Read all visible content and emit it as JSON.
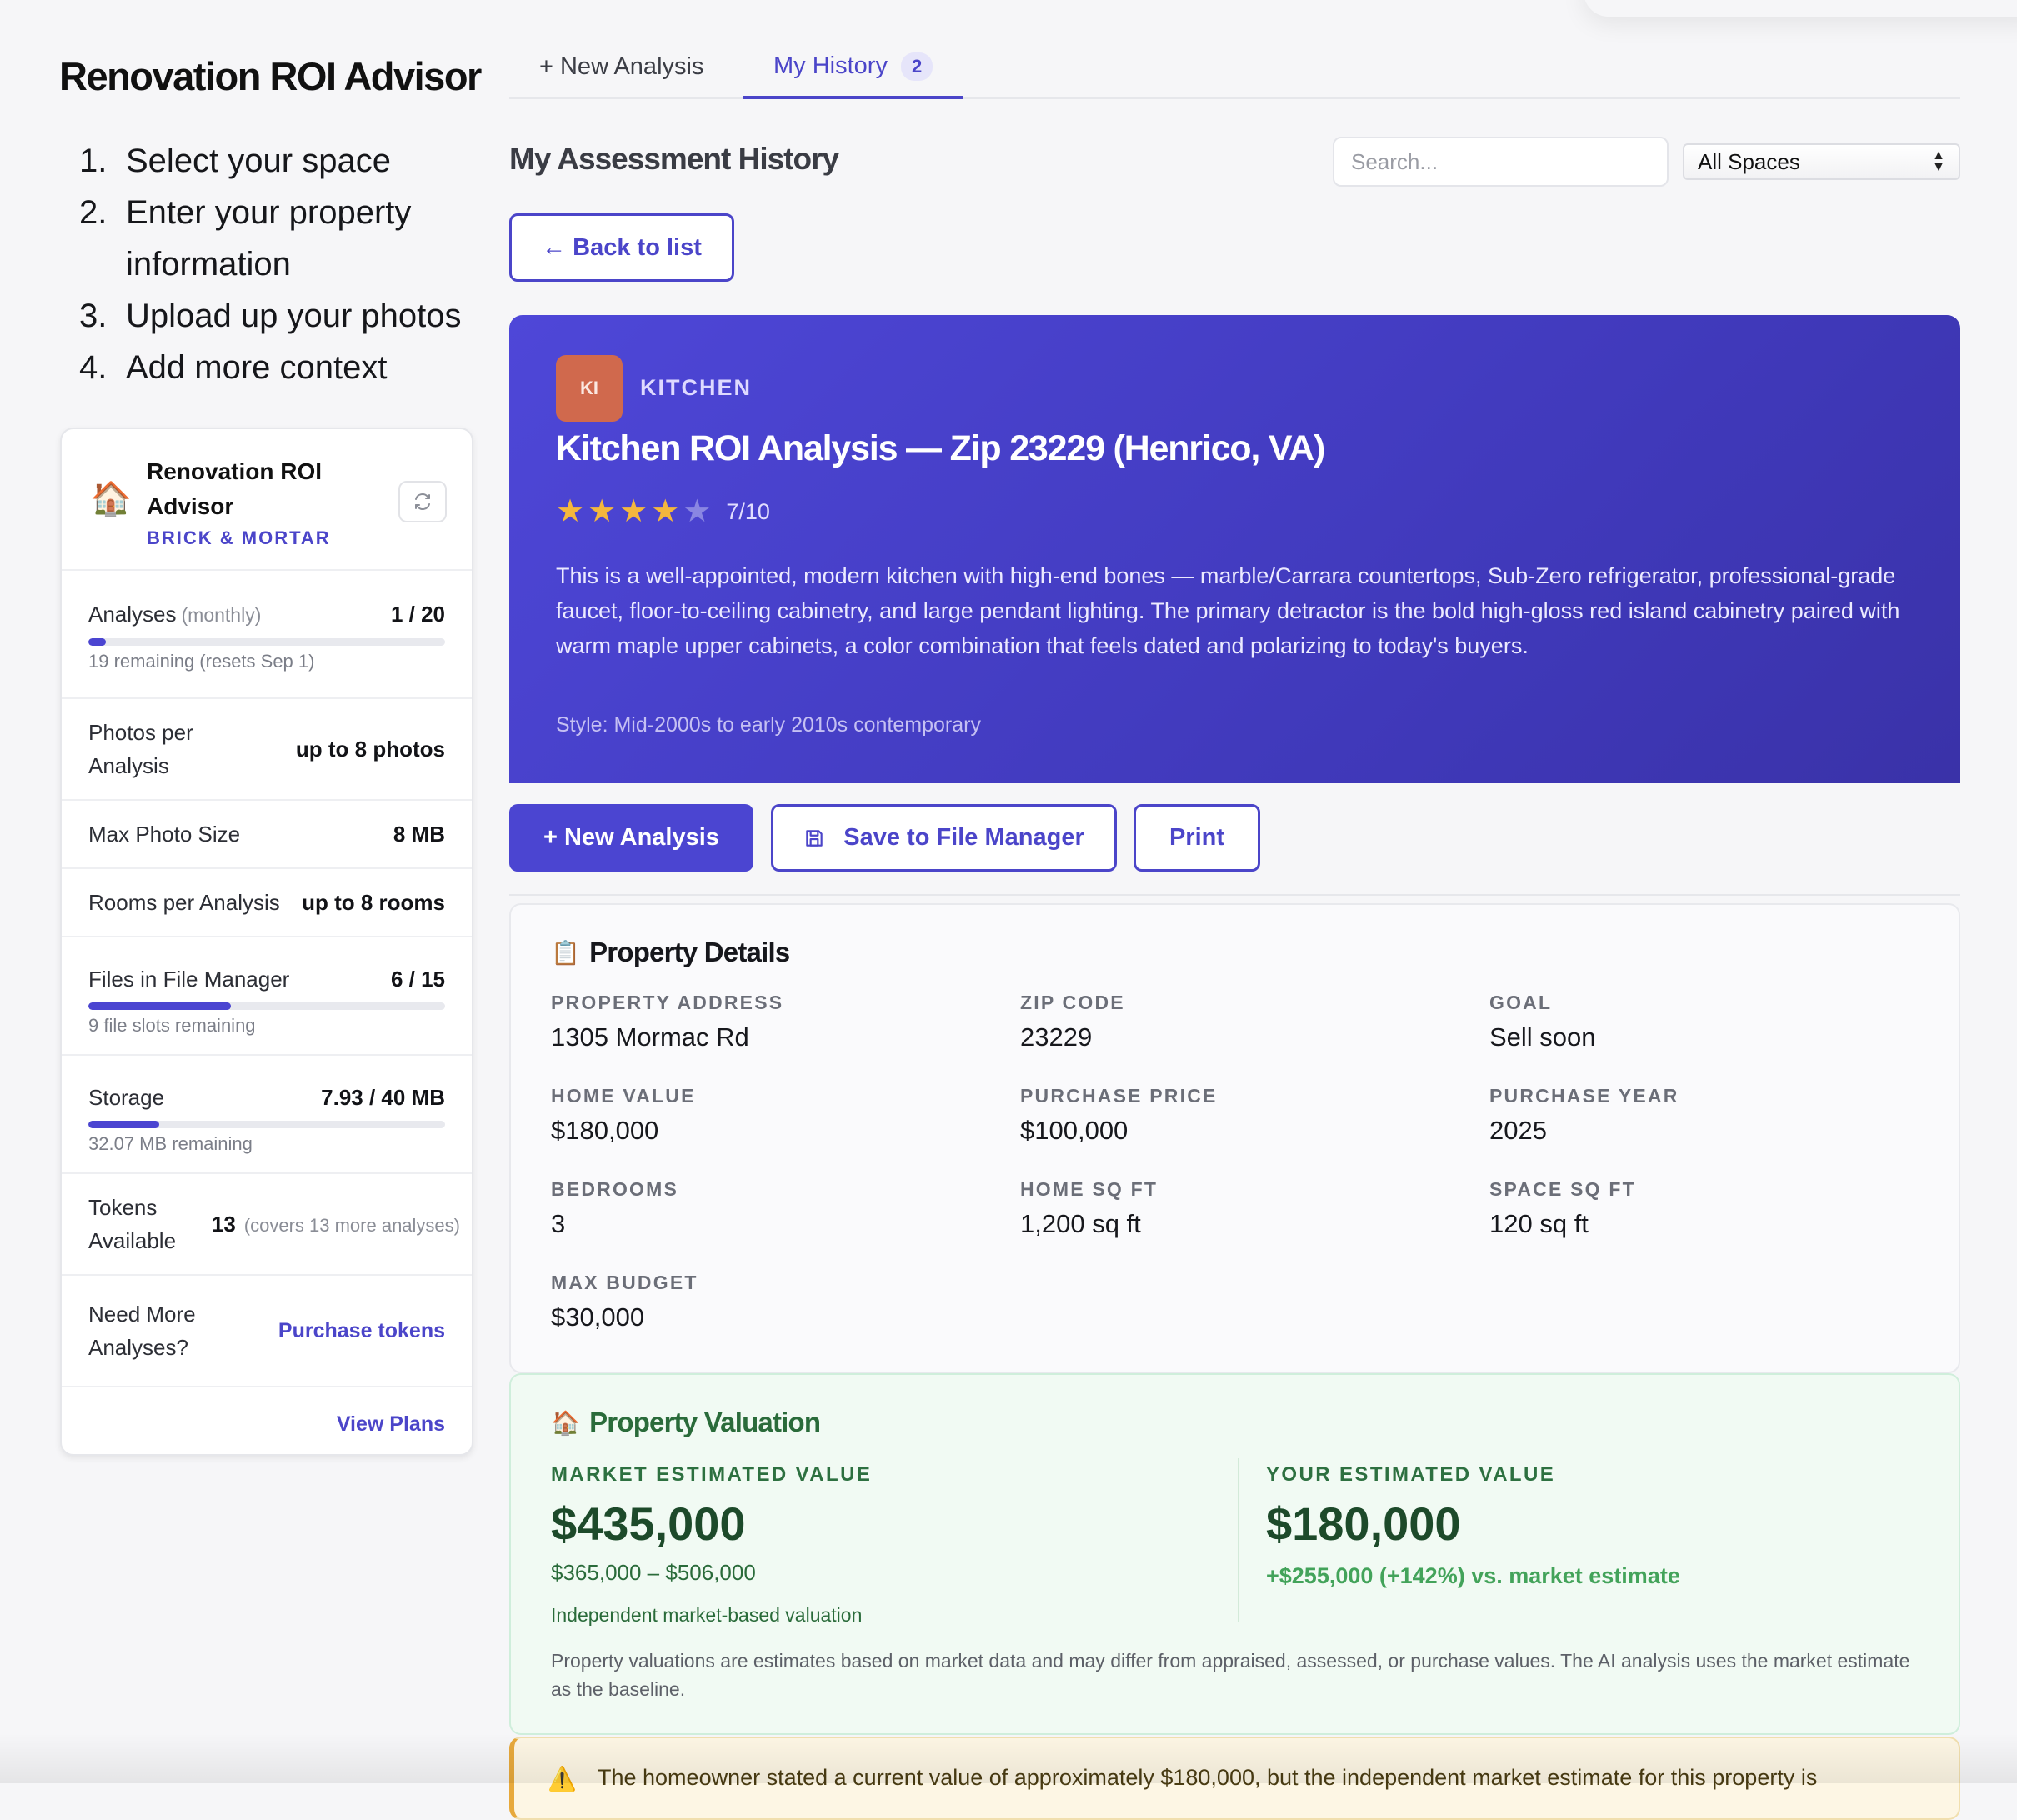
{
  "app": {
    "title": "Renovation ROI Advisor"
  },
  "steps": [
    {
      "num": "1.",
      "text": "Select your space"
    },
    {
      "num": "2.",
      "text": "Enter your property information"
    },
    {
      "num": "3.",
      "text": "Upload up your photos"
    },
    {
      "num": "4.",
      "text": "Add more context"
    }
  ],
  "plan": {
    "icon": "house-icon",
    "name": "Renovation ROI Advisor",
    "subtitle": "BRICK & MORTAR",
    "refresh_icon": "refresh-icon",
    "analyses": {
      "label": "Analyses",
      "qualifier": "(monthly)",
      "value": "1 / 20",
      "used": 1,
      "total": 20,
      "note": "19 remaining (resets Sep 1)"
    },
    "photos": {
      "label": "Photos per Analysis",
      "value": "up to 8 photos"
    },
    "max_photo": {
      "label": "Max Photo Size",
      "value": "8 MB"
    },
    "rooms": {
      "label": "Rooms per Analysis",
      "value": "up to 8 rooms"
    },
    "files": {
      "label": "Files in File Manager",
      "value": "6 / 15",
      "used": 6,
      "total": 15,
      "note": "9 file slots remaining"
    },
    "storage": {
      "label": "Storage",
      "value": "7.93 / 40 MB",
      "used": 7.93,
      "total": 40,
      "note": "32.07 MB remaining"
    },
    "tokens": {
      "label": "Tokens Available",
      "value": "13",
      "note": "(covers 13 more analyses)"
    },
    "more": {
      "label": "Need More Analyses?",
      "link": "Purchase tokens"
    },
    "view_plans": "View Plans"
  },
  "tabs": {
    "new_analysis": "+ New Analysis",
    "history": "My History",
    "history_count": "2"
  },
  "history": {
    "title": "My Assessment History",
    "search_placeholder": "Search...",
    "filter_selected": "All Spaces",
    "back_label": "← Back to list"
  },
  "report": {
    "space_code": "KI",
    "space_label": "KITCHEN",
    "title": "Kitchen ROI Analysis — Zip 23229 (Henrico, VA)",
    "rating": 7,
    "rating_max": 10,
    "stars_filled": 4,
    "stars_total": 5,
    "rating_text": "7/10",
    "description": "This is a well-appointed, modern kitchen with high-end bones — marble/Carrara countertops, Sub-Zero refrigerator, professional-grade faucet, floor-to-ceiling cabinetry, and large pendant lighting. The primary detractor is the bold high-gloss red island cabinetry paired with warm maple upper cabinets, a color combination that feels dated and polarizing to today's buyers.",
    "style": "Style: Mid-2000s to early 2010s contemporary"
  },
  "actions": {
    "new_analysis": "+ New Analysis",
    "save": "Save to File Manager",
    "save_icon": "save-icon",
    "print": "Print"
  },
  "details": {
    "title": "Property Details",
    "icon": "clipboard-icon",
    "fields": [
      {
        "label": "PROPERTY ADDRESS",
        "value": "1305 Mormac Rd"
      },
      {
        "label": "ZIP CODE",
        "value": "23229"
      },
      {
        "label": "GOAL",
        "value": "Sell soon"
      },
      {
        "label": "HOME VALUE",
        "value": "$180,000"
      },
      {
        "label": "PURCHASE PRICE",
        "value": "$100,000"
      },
      {
        "label": "PURCHASE YEAR",
        "value": "2025"
      },
      {
        "label": "BEDROOMS",
        "value": "3"
      },
      {
        "label": "HOME SQ FT",
        "value": "1,200 sq ft"
      },
      {
        "label": "SPACE SQ FT",
        "value": "120 sq ft"
      },
      {
        "label": "MAX BUDGET",
        "value": "$30,000"
      }
    ]
  },
  "valuation": {
    "title": "Property Valuation",
    "icon": "house-icon",
    "market_label": "MARKET ESTIMATED VALUE",
    "market_value": "$435,000",
    "market_range": "$365,000 – $506,000",
    "market_note": "Independent market-based valuation",
    "your_label": "YOUR ESTIMATED VALUE",
    "your_value": "$180,000",
    "diff": "+$255,000 (+142%) vs. market estimate",
    "disclaimer": "Property valuations are estimates based on market data and may differ from appraised, assessed, or purchase values. The AI analysis uses the market estimate as the baseline."
  },
  "warning": {
    "icon": "warning-icon",
    "text": "The homeowner stated a current value of approximately $180,000, but the independent market estimate for this property is"
  },
  "colors": {
    "accent": "#4b45c9",
    "hero_start": "#4e47d8",
    "hero_end": "#3a32a8",
    "chip": "#d0694d",
    "star": "#f4b73d",
    "valuation_bg": "#f1faf3",
    "valuation_text": "#2a6b3a",
    "diff_green": "#43a35a",
    "warning_bg": "#fdf6e4"
  }
}
